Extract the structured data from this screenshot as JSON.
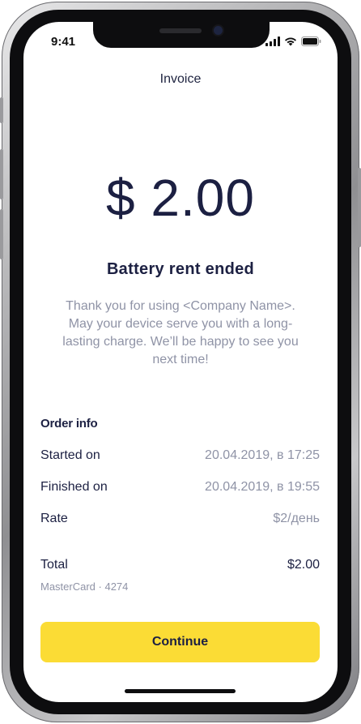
{
  "status_bar": {
    "time": "9:41"
  },
  "header": {
    "title": "Invoice"
  },
  "invoice": {
    "amount": "$ 2.00",
    "headline": "Battery rent ended",
    "message": "Thank you for using <Company Name>. May your device serve you with a long-lasting charge. We’ll be happy to see you next time!"
  },
  "order": {
    "title": "Order info",
    "rows": [
      {
        "label": "Started on",
        "value": "20.04.2019, в 17:25"
      },
      {
        "label": "Finished on",
        "value": "20.04.2019, в 19:55"
      },
      {
        "label": "Rate",
        "value": "$2/день"
      }
    ]
  },
  "total": {
    "label": "Total",
    "value": "$2.00",
    "card": "MasterCard · 4274"
  },
  "actions": {
    "continue_label": "Continue"
  },
  "colors": {
    "accent": "#fbdc35",
    "text_dark": "#1c2042",
    "text_muted": "#8f93a6"
  },
  "icons": [
    "signal-icon",
    "wifi-icon",
    "battery-icon"
  ]
}
